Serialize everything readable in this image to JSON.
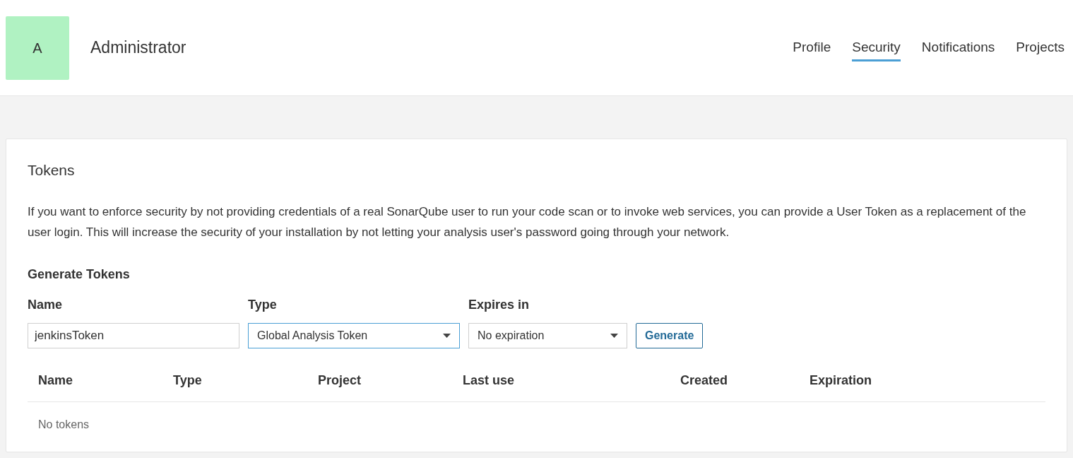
{
  "header": {
    "avatar_letter": "A",
    "user_name": "Administrator",
    "tabs": [
      {
        "label": "Profile",
        "selected": false
      },
      {
        "label": "Security",
        "selected": true
      },
      {
        "label": "Notifications",
        "selected": false
      },
      {
        "label": "Projects",
        "selected": false
      }
    ]
  },
  "tokens": {
    "title": "Tokens",
    "description": "If you want to enforce security by not providing credentials of a real SonarQube user to run your code scan or to invoke web services, you can provide a User Token as a replacement of the user login. This will increase the security of your installation by not letting your analysis user's password going through your network.",
    "generate_heading": "Generate Tokens",
    "fields": [
      {
        "kind": "input",
        "label": "Name",
        "value": "jenkinsToken",
        "focused": false
      },
      {
        "kind": "select",
        "label": "Type",
        "value": "Global Analysis Token",
        "focused": true
      },
      {
        "kind": "select",
        "label": "Expires in",
        "value": "No expiration",
        "focused": false
      }
    ],
    "generate_button": "Generate",
    "table": {
      "columns": [
        "Name",
        "Type",
        "Project",
        "Last use",
        "Created",
        "Expiration"
      ],
      "empty_text": "No tokens"
    }
  }
}
